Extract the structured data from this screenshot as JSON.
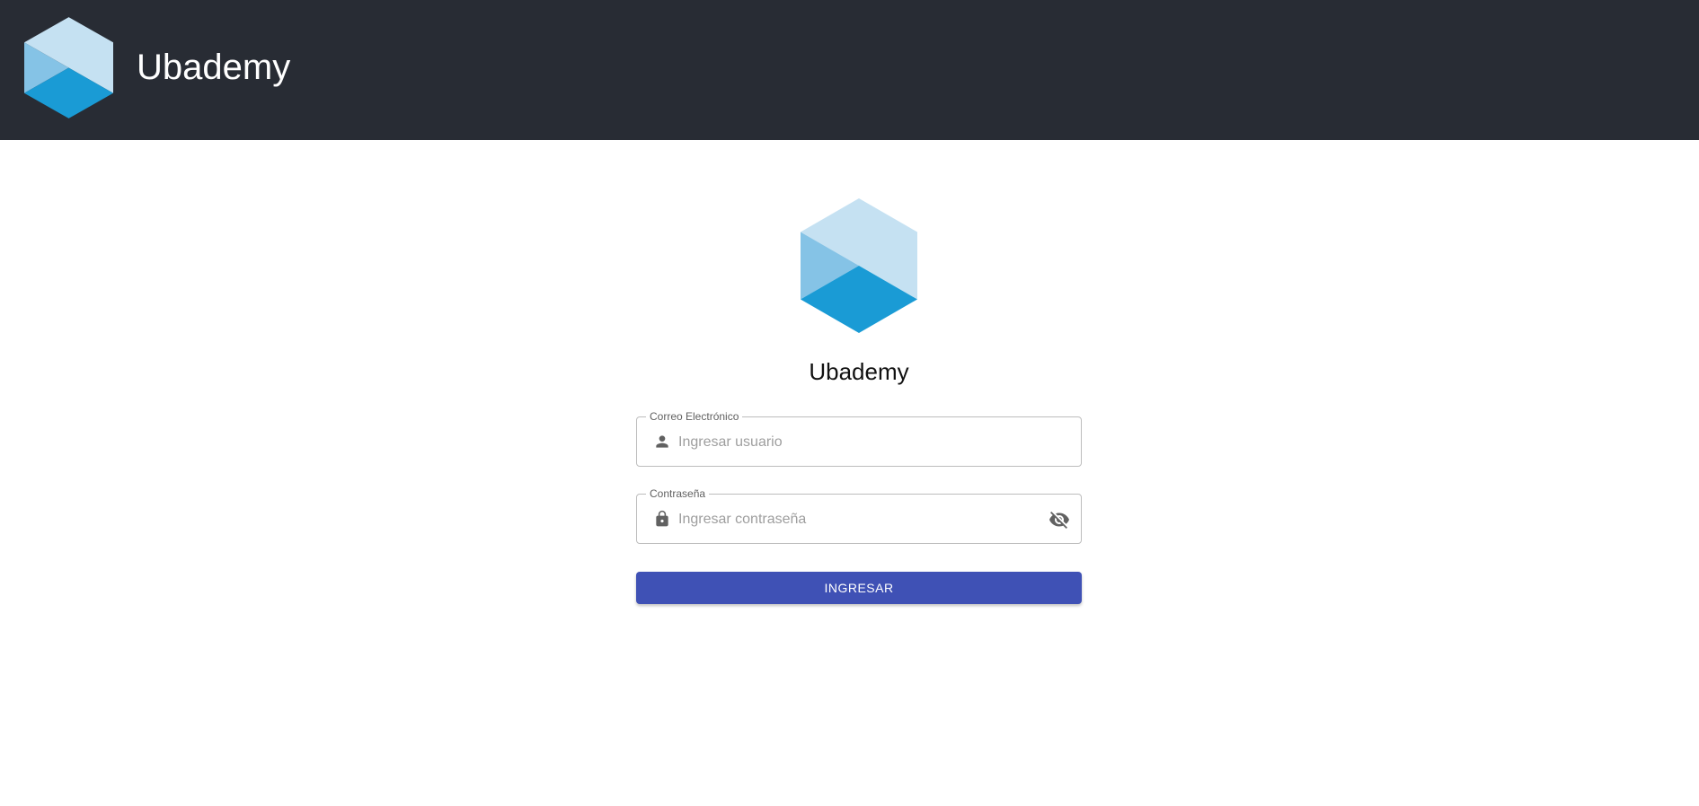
{
  "header": {
    "title": "Ubademy",
    "logo_icon": "hexagon-cube-logo-icon"
  },
  "login": {
    "title": "Ubademy",
    "logo_icon": "hexagon-cube-logo-icon",
    "email": {
      "label": "Correo Electrónico",
      "placeholder": "Ingresar usuario",
      "value": "",
      "icon": "person-icon"
    },
    "password": {
      "label": "Contraseña",
      "placeholder": "Ingresar contraseña",
      "value": "",
      "icon": "lock-icon",
      "toggle_icon": "visibility-off-icon"
    },
    "submit_label": "INGRESAR"
  },
  "colors": {
    "header_bg": "#282c34",
    "logo_light": "#c5e1f2",
    "logo_mid": "#85c3e6",
    "logo_dark": "#1a9bd5",
    "button_bg": "#3f51b5",
    "button_text": "#ffffff"
  }
}
